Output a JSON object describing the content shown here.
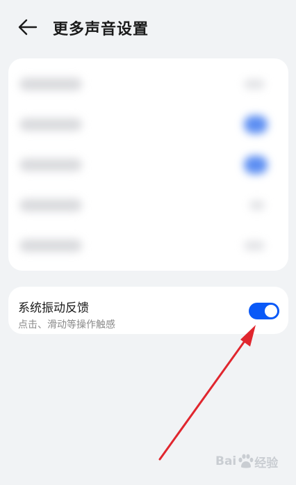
{
  "header": {
    "title": "更多声音设置",
    "back_icon": "arrow-left-icon"
  },
  "feedback": {
    "title": "系统振动反馈",
    "subtitle": "点击、滑动等操作触感",
    "toggle_on": true,
    "toggle_color": "#0a59f7"
  },
  "watermark": {
    "left": "Bai",
    "right": "经验"
  },
  "colors": {
    "background": "#f1f3f5",
    "card": "#ffffff",
    "annotation_arrow": "#e0262e"
  }
}
